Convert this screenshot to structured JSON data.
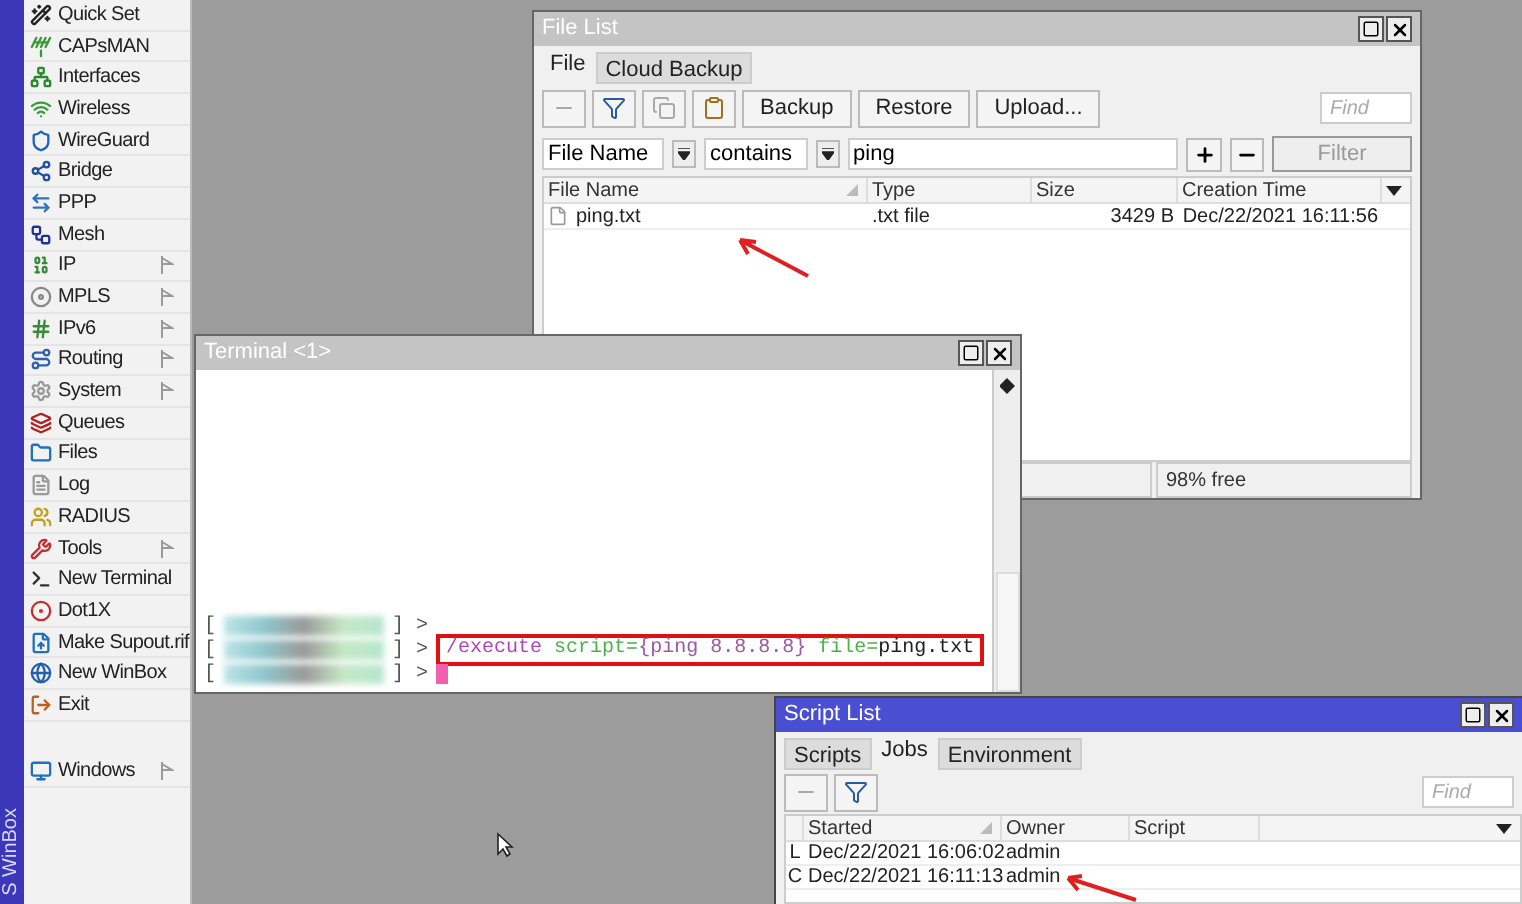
{
  "sidebar": {
    "brand": "S WinBox",
    "items": [
      {
        "label": "Quick Set",
        "submenu": false
      },
      {
        "label": "CAPsMAN",
        "submenu": false
      },
      {
        "label": "Interfaces",
        "submenu": false
      },
      {
        "label": "Wireless",
        "submenu": false
      },
      {
        "label": "WireGuard",
        "submenu": false
      },
      {
        "label": "Bridge",
        "submenu": false
      },
      {
        "label": "PPP",
        "submenu": false
      },
      {
        "label": "Mesh",
        "submenu": false
      },
      {
        "label": "IP",
        "submenu": true
      },
      {
        "label": "MPLS",
        "submenu": true
      },
      {
        "label": "IPv6",
        "submenu": true
      },
      {
        "label": "Routing",
        "submenu": true
      },
      {
        "label": "System",
        "submenu": true
      },
      {
        "label": "Queues",
        "submenu": false
      },
      {
        "label": "Files",
        "submenu": false
      },
      {
        "label": "Log",
        "submenu": false
      },
      {
        "label": "RADIUS",
        "submenu": false
      },
      {
        "label": "Tools",
        "submenu": true
      },
      {
        "label": "New Terminal",
        "submenu": false
      },
      {
        "label": "Dot1X",
        "submenu": false
      },
      {
        "label": "Make Supout.rif",
        "submenu": false
      },
      {
        "label": "New WinBox",
        "submenu": false
      },
      {
        "label": "Exit",
        "submenu": false
      }
    ],
    "windows_item": {
      "label": "Windows",
      "submenu": true
    }
  },
  "file_list": {
    "title": "File List",
    "active": false,
    "tabs": [
      {
        "label": "File",
        "selected": true
      },
      {
        "label": "Cloud Backup",
        "selected": false
      }
    ],
    "buttons": [
      "Backup",
      "Restore",
      "Upload..."
    ],
    "find_placeholder": "Find",
    "filter": {
      "field": "File Name",
      "operator": "contains",
      "value": "ping",
      "button": "Filter"
    },
    "columns": [
      "File Name",
      "Type",
      "Size",
      "Creation Time"
    ],
    "rows": [
      {
        "name": "ping.txt",
        "type": ".txt file",
        "size": "3429 B",
        "created": "Dec/22/2021 16:11:56"
      }
    ],
    "status": "98% free"
  },
  "terminal": {
    "title": "Terminal <1>",
    "active": false,
    "lines": [
      {
        "open": "[",
        "close": "] >",
        "highlighted": false,
        "cursor": false
      },
      {
        "open": "[",
        "close": "] >",
        "highlighted": true,
        "cursor": false,
        "command": [
          {
            "text": "/execute",
            "color": "#b044b8"
          },
          {
            "text": " script=",
            "color": "#4cb04c"
          },
          {
            "text": "{ping 8.8.8.8}",
            "color": "#9c5aa0"
          },
          {
            "text": " file=",
            "color": "#4cb04c"
          },
          {
            "text": "ping.txt",
            "color": "#202020"
          }
        ]
      },
      {
        "open": "[",
        "close": "] >",
        "highlighted": false,
        "cursor": true
      }
    ]
  },
  "script_list": {
    "title": "Script List",
    "active": true,
    "tabs": [
      {
        "label": "Scripts",
        "selected": false
      },
      {
        "label": "Jobs",
        "selected": true
      },
      {
        "label": "Environment",
        "selected": false
      }
    ],
    "find_placeholder": "Find",
    "columns": [
      "Started",
      "Owner",
      "Script"
    ],
    "rows": [
      {
        "flag": "L",
        "started": "Dec/22/2021 16:06:02",
        "owner": "admin"
      },
      {
        "flag": "C",
        "started": "Dec/22/2021 16:11:13",
        "owner": "admin"
      }
    ]
  }
}
